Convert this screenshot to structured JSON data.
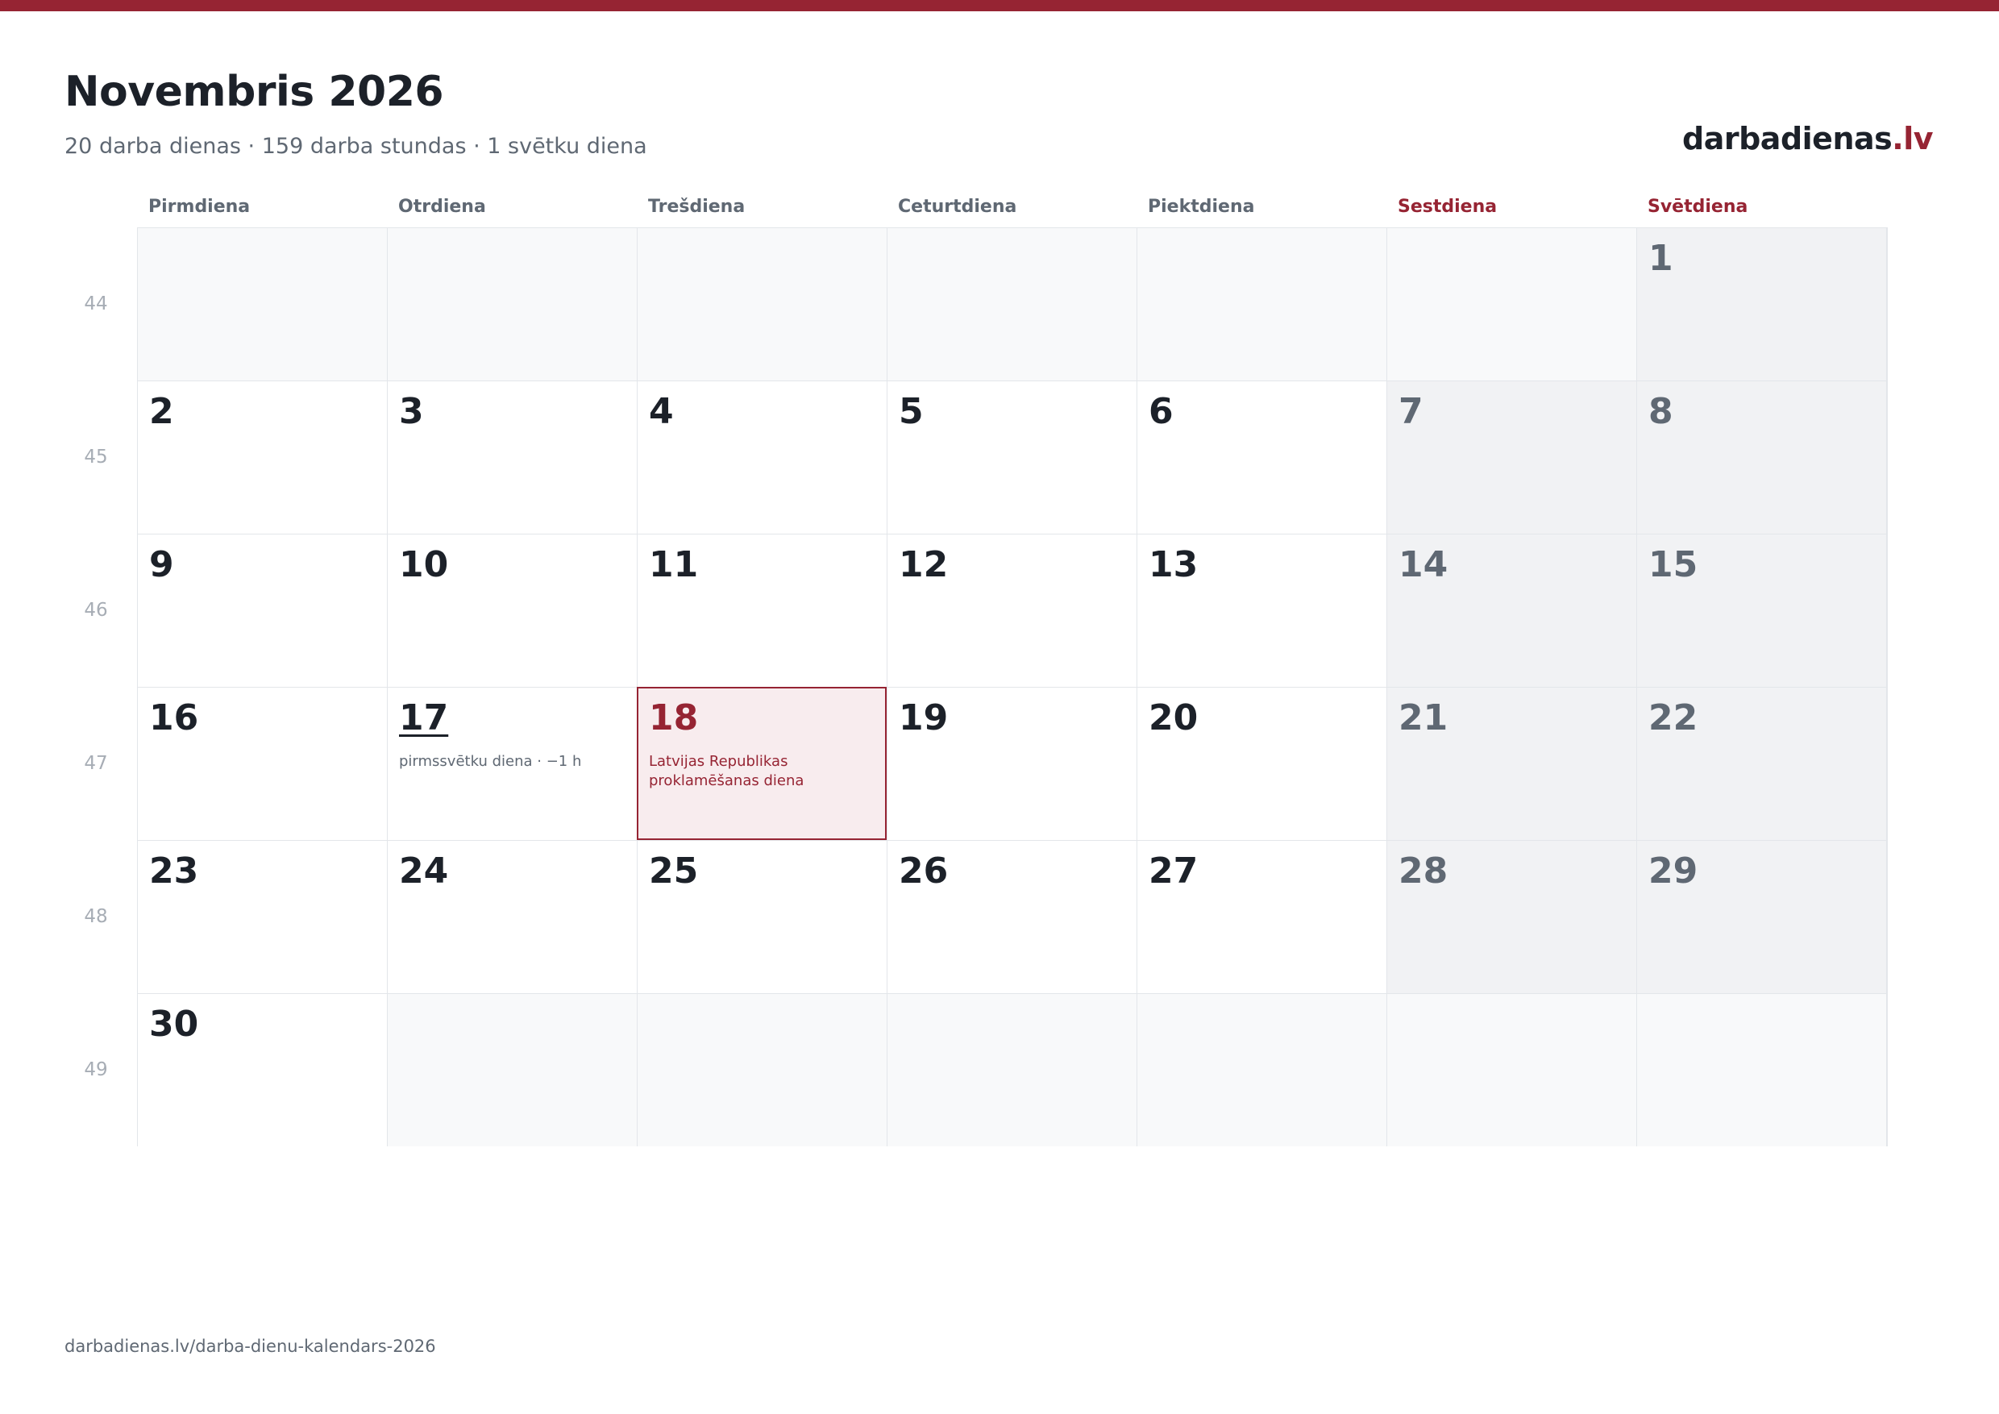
{
  "colors": {
    "accent": "#962433",
    "text": "#1c2129",
    "muted": "#5f6873",
    "weekend_bg": "#f1f2f4",
    "empty_bg": "#f8f9fa",
    "holiday_bg": "#f8ecee"
  },
  "header": {
    "title": "Novembris 2026",
    "subtitle": "20 darba dienas · 159 darba stundas · 1 svētku diena"
  },
  "brand": {
    "name": "darbadienas",
    "tld": ".lv"
  },
  "weekdays": [
    {
      "label": "Pirmdiena",
      "weekend": false
    },
    {
      "label": "Otrdiena",
      "weekend": false
    },
    {
      "label": "Trešdiena",
      "weekend": false
    },
    {
      "label": "Ceturtdiena",
      "weekend": false
    },
    {
      "label": "Piektdiena",
      "weekend": false
    },
    {
      "label": "Sestdiena",
      "weekend": true
    },
    {
      "label": "Svētdiena",
      "weekend": true
    }
  ],
  "weeks": [
    {
      "number": "44",
      "days": [
        null,
        null,
        null,
        null,
        null,
        null,
        {
          "day": "1",
          "weekend": true
        }
      ]
    },
    {
      "number": "45",
      "days": [
        {
          "day": "2"
        },
        {
          "day": "3"
        },
        {
          "day": "4"
        },
        {
          "day": "5"
        },
        {
          "day": "6"
        },
        {
          "day": "7",
          "weekend": true
        },
        {
          "day": "8",
          "weekend": true
        }
      ]
    },
    {
      "number": "46",
      "days": [
        {
          "day": "9"
        },
        {
          "day": "10"
        },
        {
          "day": "11"
        },
        {
          "day": "12"
        },
        {
          "day": "13"
        },
        {
          "day": "14",
          "weekend": true
        },
        {
          "day": "15",
          "weekend": true
        }
      ]
    },
    {
      "number": "47",
      "days": [
        {
          "day": "16"
        },
        {
          "day": "17",
          "underlined": true,
          "note": "pirmssvētku diena · −1 h"
        },
        {
          "day": "18",
          "holiday": true,
          "note": "Latvijas Republikas proklamēšanas diena"
        },
        {
          "day": "19"
        },
        {
          "day": "20"
        },
        {
          "day": "21",
          "weekend": true
        },
        {
          "day": "22",
          "weekend": true
        }
      ]
    },
    {
      "number": "48",
      "days": [
        {
          "day": "23"
        },
        {
          "day": "24"
        },
        {
          "day": "25"
        },
        {
          "day": "26"
        },
        {
          "day": "27"
        },
        {
          "day": "28",
          "weekend": true
        },
        {
          "day": "29",
          "weekend": true
        }
      ]
    },
    {
      "number": "49",
      "days": [
        {
          "day": "30"
        },
        null,
        null,
        null,
        null,
        null,
        null
      ]
    }
  ],
  "footer": {
    "url": "darbadienas.lv/darba-dienu-kalendars-2026"
  }
}
